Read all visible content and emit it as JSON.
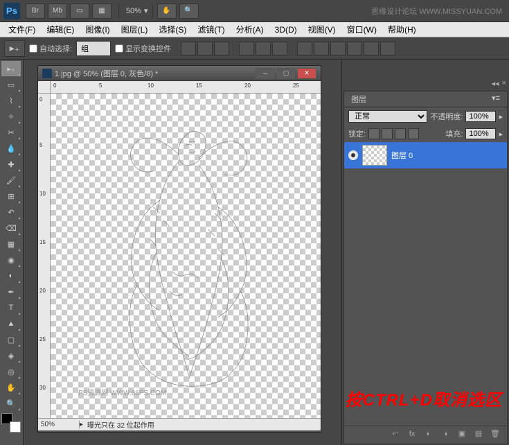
{
  "app": {
    "name": "Ps"
  },
  "watermark": {
    "top": "思缘设计论坛  WWW.MISSYUAN.COM",
    "canvas": "PS资源网  WWW.86PS.COM"
  },
  "top_bar": {
    "zoom": "50%",
    "br_label": "Br",
    "mb_label": "Mb"
  },
  "menu": {
    "file": "文件(F)",
    "edit": "编辑(E)",
    "image": "图像(I)",
    "layer": "图层(L)",
    "select": "选择(S)",
    "filter": "滤镜(T)",
    "analysis": "分析(A)",
    "ddd": "3D(D)",
    "view": "视图(V)",
    "window": "窗口(W)",
    "help": "帮助(H)"
  },
  "options": {
    "auto_select": "自动选择:",
    "group": "组",
    "show_transform": "显示变换控件"
  },
  "document": {
    "title": "1.jpg @ 50% (图层 0, 灰色/8) *",
    "ruler_h": [
      "0",
      "5",
      "10",
      "15",
      "20",
      "25"
    ],
    "ruler_v": [
      "0",
      "5",
      "10",
      "15",
      "20",
      "25",
      "30"
    ]
  },
  "status": {
    "zoom": "50%",
    "info": "曝光只在 32 位起作用"
  },
  "layers_panel": {
    "tab": "图层",
    "blend_mode": "正常",
    "opacity_label": "不透明度:",
    "opacity": "100%",
    "lock_label": "锁定:",
    "fill_label": "填充:",
    "fill": "100%",
    "layers": [
      {
        "name": "图层 0"
      }
    ]
  },
  "overlay": {
    "red_text": "按CTRL+D取消选区"
  }
}
